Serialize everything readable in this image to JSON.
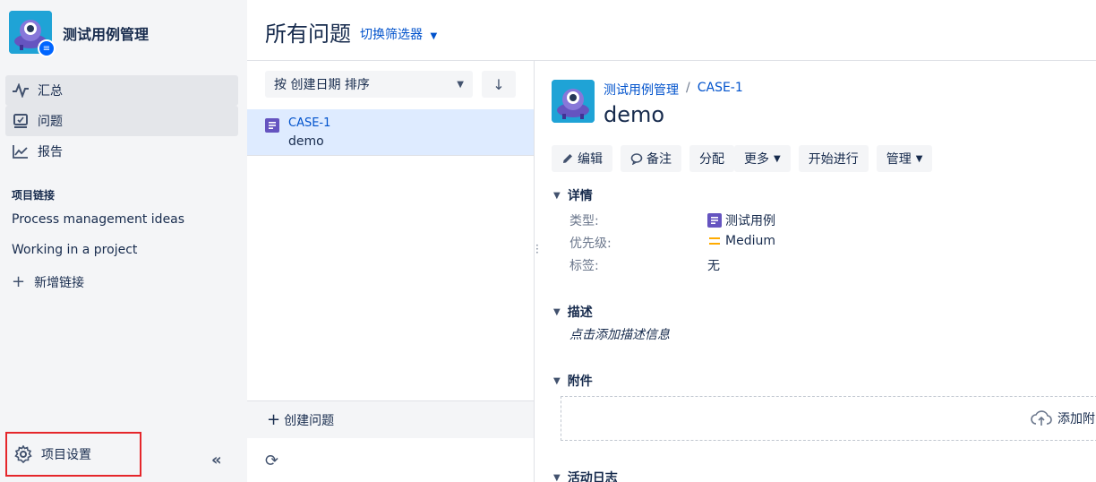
{
  "sidebar": {
    "project_name": "测试用例管理",
    "nav": [
      {
        "label": "汇总",
        "icon": "activity-icon",
        "active": true
      },
      {
        "label": "问题",
        "icon": "issues-icon",
        "active": true
      },
      {
        "label": "报告",
        "icon": "chart-line-icon",
        "active": false
      }
    ],
    "section_label": "项目链接",
    "links": [
      "Process management ideas",
      "Working in a project"
    ],
    "add_link_label": "新增链接",
    "settings_label": "项目设置",
    "collapse_glyph": "«"
  },
  "header": {
    "title": "所有问题",
    "filter_switch": "切换筛选器"
  },
  "list": {
    "sort_label": "按 创建日期 排序",
    "sort_dir_glyph": "↓",
    "issues": [
      {
        "key": "CASE-1",
        "summary": "demo"
      }
    ],
    "create_label": "创建问题",
    "refresh_glyph": "⟳"
  },
  "detail": {
    "breadcrumb_project": "测试用例管理",
    "breadcrumb_sep": "/",
    "breadcrumb_key": "CASE-1",
    "title": "demo",
    "buttons": {
      "edit": "编辑",
      "comment": "备注",
      "assign": "分配",
      "more": "更多",
      "start": "开始进行",
      "admin": "管理"
    },
    "sections": {
      "details": "详情",
      "description": "描述",
      "attachments": "附件",
      "activity": "活动日志"
    },
    "fields": [
      {
        "label": "类型:",
        "value": "测试用例",
        "icon": "test-case-icon"
      },
      {
        "label": "优先级:",
        "value": "Medium",
        "icon": "priority-medium-icon"
      },
      {
        "label": "标签:",
        "value": "无",
        "icon": ""
      }
    ],
    "description_placeholder": "点击添加描述信息",
    "attach_label": "添加附"
  },
  "colors": {
    "link": "#0052cc",
    "selected_row": "#deebff",
    "sidebar_bg": "#f4f5f7",
    "highlight_border": "#e5262b",
    "priority_medium": "#ffab00",
    "type_purple": "#6554c0"
  }
}
